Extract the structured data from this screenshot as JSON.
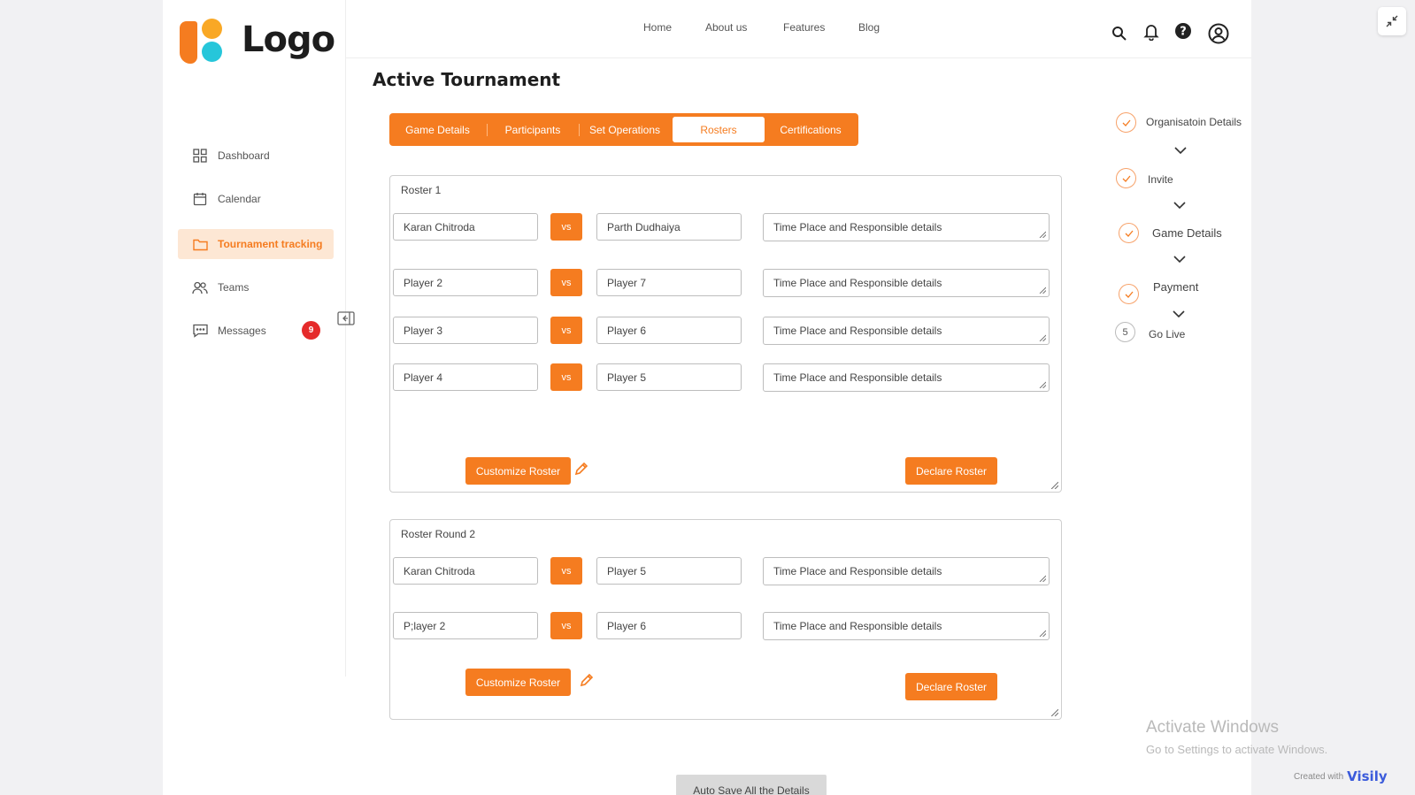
{
  "brand": {
    "logo_text": "Logo"
  },
  "topnav": [
    "Home",
    "About us",
    "Features",
    "Blog"
  ],
  "sidebar": {
    "items": [
      {
        "label": "Dashboard",
        "icon": "dashboard-icon"
      },
      {
        "label": "Calendar",
        "icon": "calendar-icon"
      },
      {
        "label": "Tournament tracking",
        "icon": "folder-icon",
        "active": true
      },
      {
        "label": "Teams",
        "icon": "users-icon"
      },
      {
        "label": "Messages",
        "icon": "message-icon",
        "badge": "9"
      }
    ]
  },
  "page": {
    "title": "Active Tournament"
  },
  "tabs": [
    "Game Details",
    "Participants",
    "Set Operations",
    "Rosters",
    "Certifications"
  ],
  "active_tab": "Rosters",
  "rosters": [
    {
      "title": "Roster 1",
      "matches": [
        {
          "p1": "Karan Chitroda",
          "vs": "vs",
          "p2": "Parth Dudhaiya",
          "details": "Time Place and Responsible details"
        },
        {
          "p1": "Player 2",
          "vs": "vs",
          "p2": "Player 7",
          "details": "Time Place and Responsible details"
        },
        {
          "p1": "Player 3",
          "vs": "vs",
          "p2": "Player 6",
          "details": "Time Place and Responsible details"
        },
        {
          "p1": "Player 4",
          "vs": "vs",
          "p2": "Player 5",
          "details": "Time Place and Responsible details"
        }
      ],
      "customize_label": "Customize Roster",
      "declare_label": "Declare Roster"
    },
    {
      "title": "Roster Round 2",
      "matches": [
        {
          "p1": "Karan Chitroda",
          "vs": "vs",
          "p2": "Player 5",
          "details": "Time Place and Responsible details"
        },
        {
          "p1": "P;layer 2",
          "vs": "vs",
          "p2": "Player 6",
          "details": "Time Place and Responsible details"
        }
      ],
      "customize_label": "Customize Roster",
      "declare_label": "Declare Roster"
    }
  ],
  "steps": [
    {
      "label": "Organisatoin Details",
      "status": "done"
    },
    {
      "label": "Invite",
      "status": "done"
    },
    {
      "label": "Game Details",
      "status": "done"
    },
    {
      "label": "Payment",
      "status": "done"
    },
    {
      "label": "Go Live",
      "status": "pending",
      "number": "5"
    }
  ],
  "autosave_label": "Auto Save All the Details",
  "watermark": {
    "title": "Activate Windows",
    "subtitle": "Go to Settings to activate Windows."
  },
  "footer": {
    "created_with": "Created with",
    "brand": "Visily"
  },
  "colors": {
    "accent": "#f57c20",
    "accent_light": "#fde7d4",
    "badge": "#e52b2b"
  }
}
